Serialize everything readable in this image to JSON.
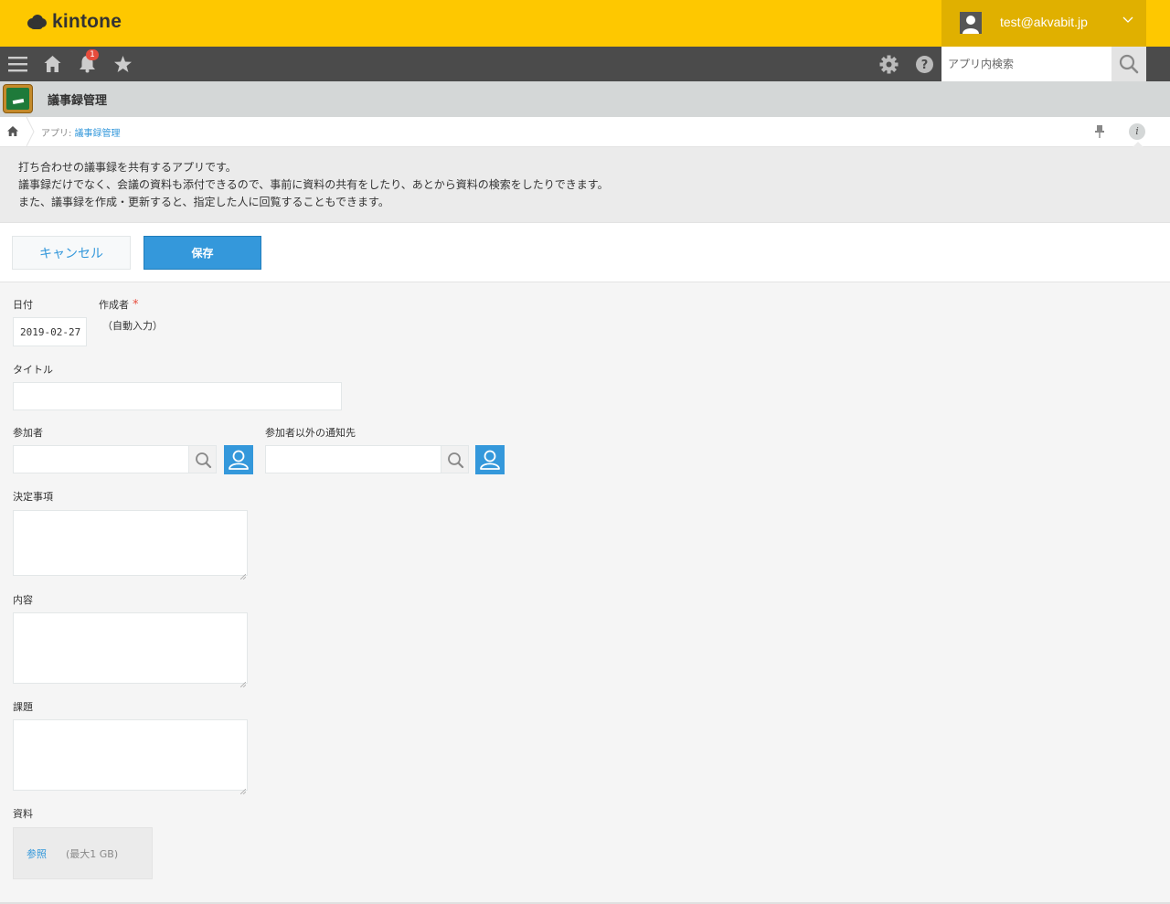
{
  "header": {
    "logo_text": "kintone",
    "user_email": "test@akvabit.jp",
    "accent_color": "#fec800"
  },
  "gnav": {
    "notification_count": "1",
    "search_placeholder": "アプリ内検索",
    "icons": [
      "menu-icon",
      "home-icon",
      "bell-icon",
      "star-icon",
      "gear-icon",
      "help-icon",
      "search-icon"
    ]
  },
  "app": {
    "title": "議事録管理"
  },
  "breadcrumb": {
    "prefix": "アプリ: ",
    "link": "議事録管理"
  },
  "description": {
    "lines": [
      "打ち合わせの議事録を共有するアプリです。",
      "議事録だけでなく、会議の資料も添付できるので、事前に資料の共有をしたり、あとから資料の検索をしたりできます。",
      "また、議事録を作成・更新すると、指定した人に回覧することもできます。"
    ]
  },
  "actions": {
    "cancel_label": "キャンセル",
    "save_label": "保存"
  },
  "form": {
    "date": {
      "label": "日付",
      "value": "2019-02-27"
    },
    "author": {
      "label": "作成者",
      "required_mark": "*",
      "value": "（自動入力）"
    },
    "title": {
      "label": "タイトル",
      "value": ""
    },
    "participants": {
      "label": "参加者",
      "value": ""
    },
    "notify_others": {
      "label": "参加者以外の通知先",
      "value": ""
    },
    "decisions": {
      "label": "決定事項",
      "value": ""
    },
    "content": {
      "label": "内容",
      "value": ""
    },
    "issues": {
      "label": "課題",
      "value": ""
    },
    "attachments": {
      "label": "資料",
      "browse_label": "参照",
      "max_size": "(最大1 GB)"
    }
  }
}
